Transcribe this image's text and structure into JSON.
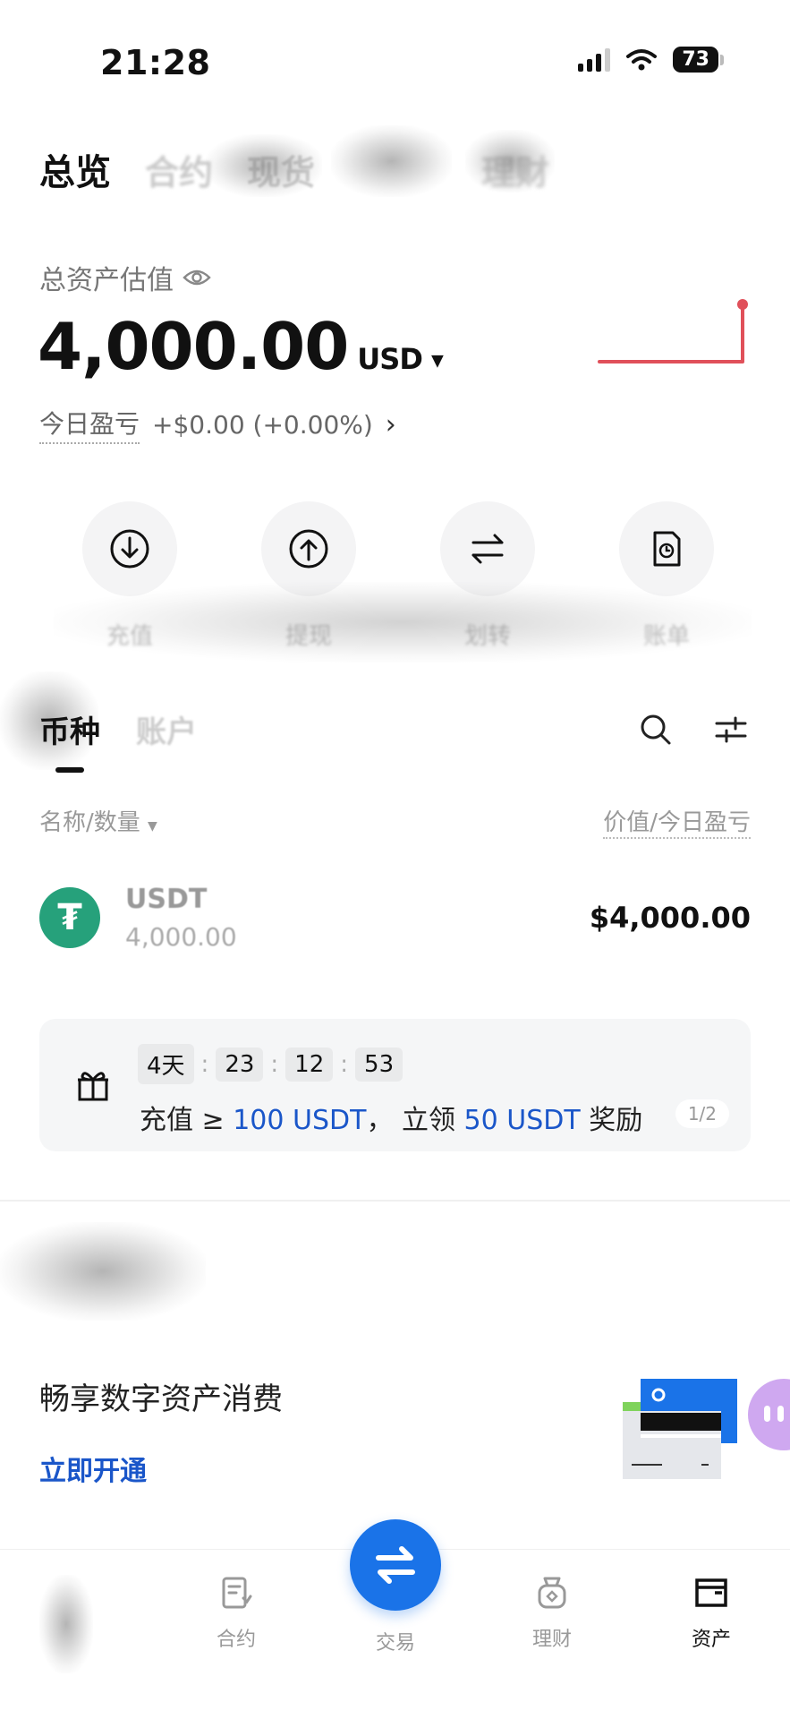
{
  "status_bar": {
    "time": "21:28",
    "battery": "73"
  },
  "top_tabs": [
    {
      "label": "总览",
      "active": true
    },
    {
      "label": "合约",
      "active": false
    },
    {
      "label": "现货",
      "active": false
    },
    {
      "label": "",
      "active": false
    },
    {
      "label": "理财",
      "active": false
    }
  ],
  "asset": {
    "label": "总资产估值",
    "value": "4,000.00",
    "unit": "USD",
    "pnl_label": "今日盈亏",
    "pnl_value": "+$0.00 (+0.00%)"
  },
  "actions": [
    {
      "label": "充值",
      "icon": "deposit-icon"
    },
    {
      "label": "提现",
      "icon": "withdraw-icon"
    },
    {
      "label": "划转",
      "icon": "transfer-icon"
    },
    {
      "label": "账单",
      "icon": "bill-icon"
    }
  ],
  "coin_tabs": [
    {
      "label": "币种",
      "active": true
    },
    {
      "label": "账户",
      "active": false
    }
  ],
  "list_header": {
    "left": "名称/数量",
    "right": "价值/今日盈亏"
  },
  "coins": [
    {
      "symbol": "USDT",
      "quantity": "4,000.00",
      "value": "$4,000.00",
      "logo_char": "₮"
    }
  ],
  "promo": {
    "timer": {
      "days": "4天",
      "hours": "23",
      "minutes": "12",
      "seconds": "53"
    },
    "text_prefix": "充值 ≥ ",
    "amount": "100 USDT",
    "text_middle": "， 立领 ",
    "reward": "50 USDT",
    "text_suffix": " 奖励",
    "pager": "1/2"
  },
  "card_promo": {
    "title": "畅享数字资产消费",
    "link": "立即开通"
  },
  "bottom_nav": {
    "items": [
      {
        "label": "",
        "icon": "home-icon"
      },
      {
        "label": "合约",
        "icon": "contract-icon"
      },
      {
        "label": "交易",
        "icon": "trade-icon"
      },
      {
        "label": "理财",
        "icon": "finance-icon"
      },
      {
        "label": "资产",
        "icon": "assets-icon"
      }
    ]
  },
  "colors": {
    "accent": "#1a73e8",
    "link": "#1a56c9",
    "sparkline": "#e0505a",
    "usdt": "#26a17b"
  }
}
